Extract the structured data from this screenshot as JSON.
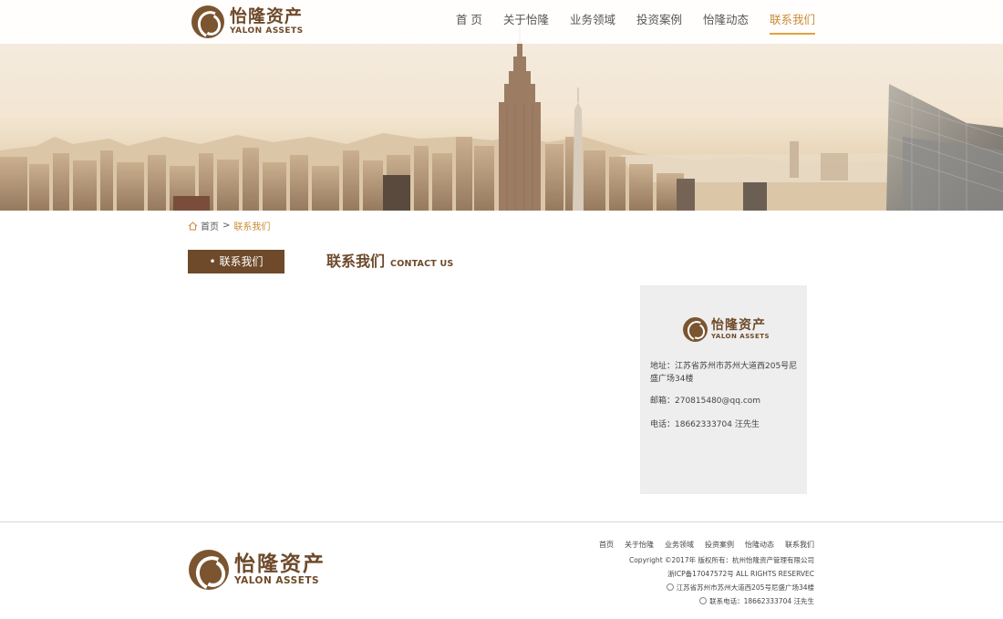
{
  "header": {
    "logo_cn": "怡隆资产",
    "logo_en": "YALON ASSETS",
    "nav": [
      {
        "label": "首 页"
      },
      {
        "label": "关于怡隆"
      },
      {
        "label": "业务领域"
      },
      {
        "label": "投资案例"
      },
      {
        "label": "怡隆动态"
      },
      {
        "label": "联系我们"
      }
    ],
    "active_color": "#c98b35"
  },
  "breadcrumb": {
    "home": "首页",
    "separator": ">",
    "current": "联系我们"
  },
  "sidebar": {
    "button_label": "• 联系我们"
  },
  "main": {
    "title_cn": "联系我们",
    "title_en": "CONTACT US"
  },
  "contact_card": {
    "logo_cn": "怡隆资产",
    "logo_en": "YALON ASSETS",
    "address": "地址：江苏省苏州市苏州大道西205号尼盛广场34楼",
    "email": "邮箱：270815480@qq.com",
    "phone": "电话：18662333704 汪先生"
  },
  "footer": {
    "logo_cn": "怡隆资产",
    "logo_en": "YALON ASSETS",
    "nav": [
      "首页",
      "关于怡隆",
      "业务领域",
      "投资案例",
      "怡隆动态",
      "联系我们"
    ],
    "copyright": "Copyright ©2017年 版权所有：杭州怡隆资产管理有限公司",
    "icp": "浙ICP备17047572号 ALL RIGHTS RESERVEC",
    "address": "江苏省苏州市苏州大道西205号尼盛广场34楼",
    "phone": "联系电话：18662333704 汪先生"
  },
  "colors": {
    "brand_brown": "#6e4a2a",
    "accent_orange": "#e0a23e"
  }
}
